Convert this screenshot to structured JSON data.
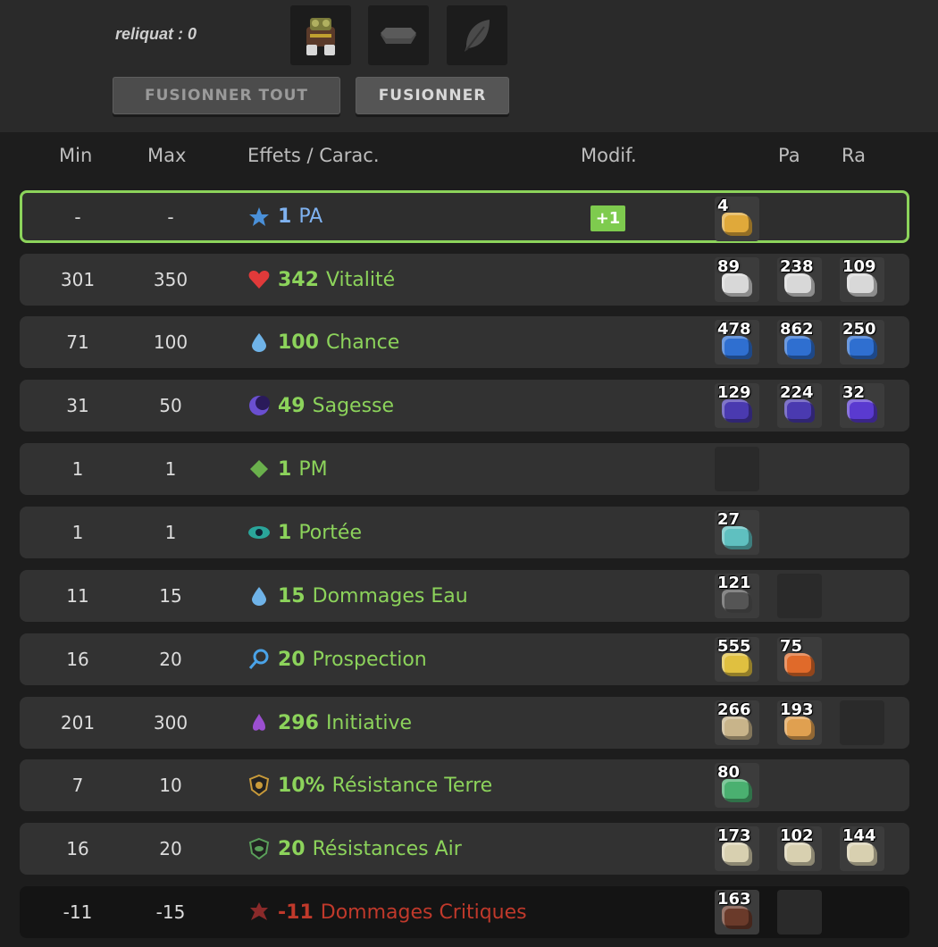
{
  "top": {
    "reliquat_label": "reliquat : 0",
    "slots": [
      {
        "name": "item-slot",
        "icon": "armor-icon"
      },
      {
        "name": "rune-slot",
        "icon": "rune-plate-icon"
      },
      {
        "name": "feather-slot",
        "icon": "feather-icon"
      }
    ],
    "buttons": {
      "merge_all": "FUSIONNER TOUT",
      "merge": "FUSIONNER"
    }
  },
  "header": {
    "min": "Min",
    "max": "Max",
    "effects": "Effets / Carac.",
    "modif": "Modif.",
    "pa": "Pa",
    "ra": "Ra"
  },
  "rows": [
    {
      "min": "-",
      "max": "-",
      "value": "1",
      "name": "PA",
      "icon": "star-icon",
      "icon_color": "#4a90d9",
      "modif": "+1",
      "style": "selected",
      "runes": [
        {
          "count": "4",
          "color": "#e0a93a"
        }
      ]
    },
    {
      "min": "301",
      "max": "350",
      "value": "342",
      "name": "Vitalité",
      "icon": "heart-icon",
      "icon_color": "#e03a3a",
      "runes": [
        {
          "count": "89",
          "color": "#d8d8d8"
        },
        {
          "count": "238",
          "color": "#d8d8d8"
        },
        {
          "count": "109",
          "color": "#d8d8d8"
        }
      ]
    },
    {
      "min": "71",
      "max": "100",
      "value": "100",
      "name": "Chance",
      "icon": "water-drop-icon",
      "icon_color": "#6fb3e8",
      "runes": [
        {
          "count": "478",
          "color": "#2f6fd0"
        },
        {
          "count": "862",
          "color": "#2f6fd0"
        },
        {
          "count": "250",
          "color": "#2f6fd0"
        }
      ]
    },
    {
      "min": "31",
      "max": "50",
      "value": "49",
      "name": "Sagesse",
      "icon": "moon-icon",
      "icon_color": "#6a4fd0",
      "runes": [
        {
          "count": "129",
          "color": "#4a3ab0"
        },
        {
          "count": "224",
          "color": "#4a3ab0"
        },
        {
          "count": "32",
          "color": "#5a3ad0"
        }
      ]
    },
    {
      "min": "1",
      "max": "1",
      "value": "1",
      "name": "PM",
      "icon": "diamond-icon",
      "icon_color": "#6ab04c",
      "runes": [
        {
          "count": "",
          "color": "empty"
        }
      ]
    },
    {
      "min": "1",
      "max": "1",
      "value": "1",
      "name": "Portée",
      "icon": "eye-icon",
      "icon_color": "#2aa59a",
      "runes": [
        {
          "count": "27",
          "color": "#5fc0c0"
        }
      ]
    },
    {
      "min": "11",
      "max": "15",
      "value": "15",
      "name": "Dommages Eau",
      "icon": "water-drop-icon",
      "icon_color": "#6fb3e8",
      "runes": [
        {
          "count": "121",
          "color": "#555555"
        },
        {
          "count": "",
          "color": "empty"
        }
      ]
    },
    {
      "min": "16",
      "max": "20",
      "value": "20",
      "name": "Prospection",
      "icon": "magnifier-icon",
      "icon_color": "#4aa3e8",
      "runes": [
        {
          "count": "555",
          "color": "#e0c040"
        },
        {
          "count": "75",
          "color": "#e06a2a"
        }
      ]
    },
    {
      "min": "201",
      "max": "300",
      "value": "296",
      "name": "Initiative",
      "icon": "fleur-icon",
      "icon_color": "#9b4fd0",
      "runes": [
        {
          "count": "266",
          "color": "#c8b48a"
        },
        {
          "count": "193",
          "color": "#e0a050"
        },
        {
          "count": "",
          "color": "empty"
        }
      ]
    },
    {
      "min": "7",
      "max": "10",
      "value": "10%",
      "name": "Résistance Terre",
      "icon": "shield-earth-icon",
      "icon_color": "#c89a3a",
      "runes": [
        {
          "count": "80",
          "color": "#4ab070"
        }
      ]
    },
    {
      "min": "16",
      "max": "20",
      "value": "20",
      "name": "Résistances Air",
      "icon": "shield-air-icon",
      "icon_color": "#5aa05a",
      "runes": [
        {
          "count": "173",
          "color": "#d8d0b0"
        },
        {
          "count": "102",
          "color": "#d8d0b0"
        },
        {
          "count": "144",
          "color": "#d8d0b0"
        }
      ]
    },
    {
      "min": "-11",
      "max": "-15",
      "value": "-11",
      "name": "Dommages Critiques",
      "icon": "critical-icon",
      "icon_color": "#8a2a2a",
      "style": "negative",
      "runes": [
        {
          "count": "163",
          "color": "#6a3a2a"
        },
        {
          "count": "",
          "color": "empty"
        }
      ]
    }
  ]
}
